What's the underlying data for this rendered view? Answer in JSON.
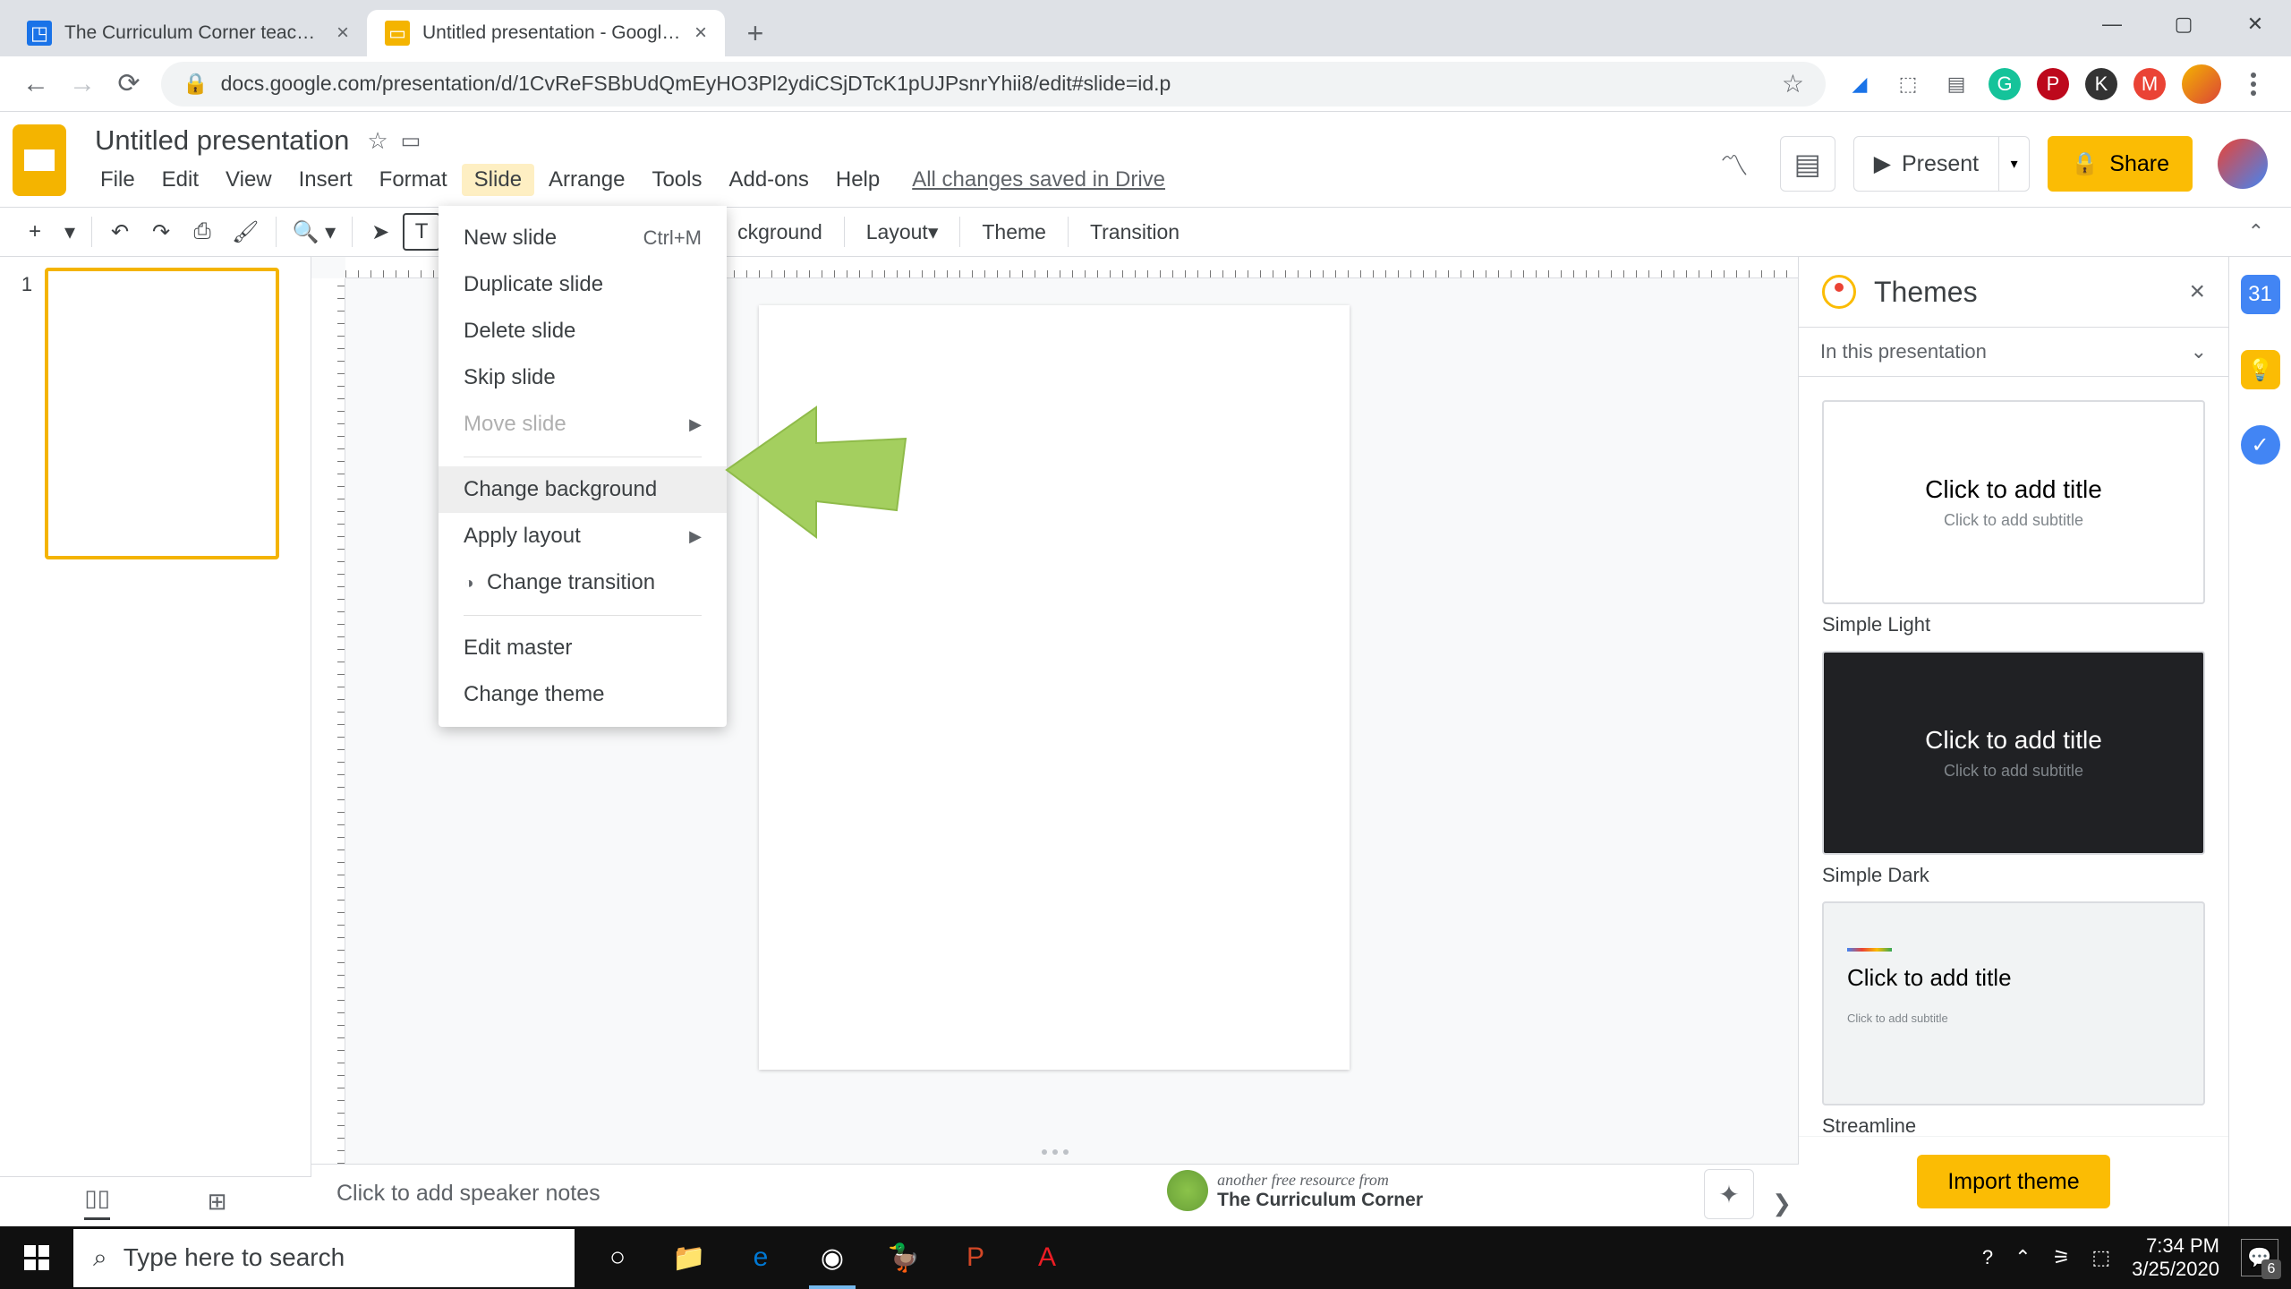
{
  "chrome": {
    "tabs": [
      {
        "title": "The Curriculum Corner teachers",
        "favicon_bg": "#1a73e8"
      },
      {
        "title": "Untitled presentation - Google Sl",
        "favicon_bg": "#f4b400"
      }
    ],
    "url": "docs.google.com/presentation/d/1CvReFSBbUdQmEyHO3Pl2ydiCSjDTcK1pUJPsnrYhii8/edit#slide=id.p"
  },
  "doc": {
    "title": "Untitled presentation",
    "menus": [
      "File",
      "Edit",
      "View",
      "Insert",
      "Format",
      "Slide",
      "Arrange",
      "Tools",
      "Add-ons",
      "Help"
    ],
    "menu_open_index": 5,
    "save_status": "All changes saved in Drive",
    "present": "Present",
    "share": "Share"
  },
  "toolbar_extra": {
    "background": "ckground",
    "layout": "Layout",
    "theme": "Theme",
    "transition": "Transition"
  },
  "dropdown": {
    "items": [
      {
        "label": "New slide",
        "shortcut": "Ctrl+M"
      },
      {
        "label": "Duplicate slide"
      },
      {
        "label": "Delete slide"
      },
      {
        "label": "Skip slide"
      },
      {
        "label": "Move slide",
        "submenu": true,
        "disabled": true
      },
      {
        "divider": true
      },
      {
        "label": "Change background",
        "hovered": true
      },
      {
        "label": "Apply layout",
        "submenu": true
      },
      {
        "label": "Change transition",
        "icon": "◑"
      },
      {
        "divider": true
      },
      {
        "label": "Edit master"
      },
      {
        "label": "Change theme"
      }
    ]
  },
  "filmstrip": {
    "slide_number": "1"
  },
  "notes": {
    "placeholder": "Click to add speaker notes"
  },
  "themes_panel": {
    "title": "Themes",
    "filter": "In this presentation",
    "themes": [
      {
        "name": "Simple Light",
        "variant": "light",
        "title_text": "Click to add title",
        "sub_text": "Click to add subtitle"
      },
      {
        "name": "Simple Dark",
        "variant": "dark",
        "title_text": "Click to add title",
        "sub_text": "Click to add subtitle"
      },
      {
        "name": "Streamline",
        "variant": "accent",
        "title_text": "Click to add title",
        "sub_text": "Click to add subtitle"
      }
    ],
    "import": "Import theme"
  },
  "watermark": {
    "line1": "another free resource from",
    "line2": "The Curriculum Corner"
  },
  "taskbar": {
    "search_placeholder": "Type here to search",
    "time": "7:34 PM",
    "date": "3/25/2020",
    "notif_count": "6"
  }
}
